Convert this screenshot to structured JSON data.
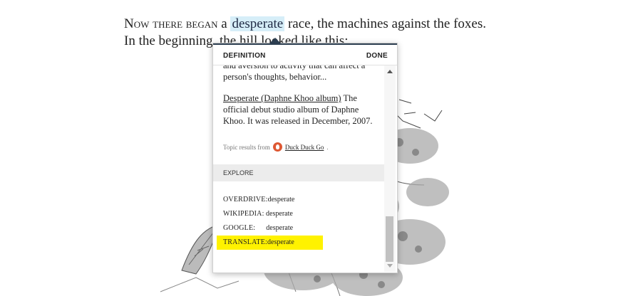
{
  "book": {
    "line1_smallcaps": "Now there began",
    "line1_pre": " a ",
    "selected_word": "desperate",
    "line1_post": " race, the machines against the foxes.",
    "line2": "In the beginning, the hill looked like this:"
  },
  "popup": {
    "title": "DEFINITION",
    "done_label": "DONE",
    "snippet": "and aversion to activity that can affect a person's thoughts, behavior...",
    "result_link": "Desperate (Daphne Khoo album)",
    "result_text": " The official debut studio album of Daphne Khoo. It was released in December, 2007.",
    "topic_prefix": "Topic results from",
    "topic_source": "Duck Duck Go",
    "topic_suffix": ".",
    "explore_label": "EXPLORE",
    "explore_items": [
      {
        "label": "OVERDRIVE:",
        "term": "desperate"
      },
      {
        "label": "WIKIPEDIA:",
        "term": "desperate"
      },
      {
        "label": "GOOGLE:",
        "term": "desperate"
      },
      {
        "label": "TRANSLATE:",
        "term": "desperate"
      }
    ]
  },
  "colors": {
    "highlight": "#fff200",
    "selection": "#d6eef8",
    "accent": "#2c3e50",
    "ddg_logo": "#de5833"
  },
  "icons": [
    "duckduckgo-logo-icon",
    "scroll-up-arrow-icon",
    "scroll-down-arrow-icon"
  ]
}
